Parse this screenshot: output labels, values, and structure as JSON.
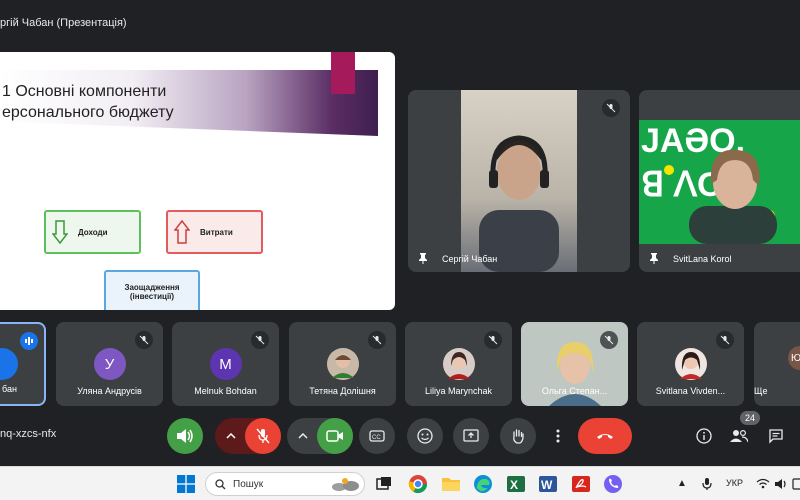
{
  "presenter": {
    "label": "ргій Чабан (Презентація)"
  },
  "slide": {
    "title": "1 Основні компоненти\nерсонального бюджету",
    "boxes": {
      "income": "Доходи",
      "expense": "Витрати",
      "savings": "Заощадження\n(інвестиції)"
    },
    "colors": {
      "accent": "#a51a5a",
      "income": "#5cc05c",
      "expense": "#e35c5c",
      "savings": "#5aa8e2"
    }
  },
  "tiles": {
    "main": [
      {
        "name": "Сергій Чабан",
        "pinned": true,
        "muted": true
      },
      {
        "name": "SvitLana Korol",
        "pinned": true,
        "muted": false
      }
    ],
    "strip": [
      {
        "name": "бан",
        "avatar": "",
        "avatar_color": "#1a73e8",
        "speaking": true
      },
      {
        "name": "Уляна Андрусів",
        "avatar": "У",
        "avatar_color": "#7e57c2"
      },
      {
        "name": "Melnuk Bohdan",
        "avatar": "M",
        "avatar_color": "#5e35b1"
      },
      {
        "name": "Тетяна Долішня",
        "avatar": "",
        "avatar_color": "#8d6e63"
      },
      {
        "name": "Liliya Marynchak",
        "avatar": "",
        "avatar_color": "#6d4c41"
      },
      {
        "name": "Ольга Степан...",
        "avatar": "",
        "avatar_color": "#a1887f"
      },
      {
        "name": "Svitlana Vivden...",
        "avatar": "",
        "avatar_color": "#4e342e"
      },
      {
        "name": "Ще",
        "avatar": "Ю",
        "avatar_color": "#795548"
      }
    ]
  },
  "meeting": {
    "code": "nq-xzcs-nfx",
    "participants_count": "24"
  },
  "taskbar": {
    "search_placeholder": "Пошук",
    "language": "УКР"
  }
}
